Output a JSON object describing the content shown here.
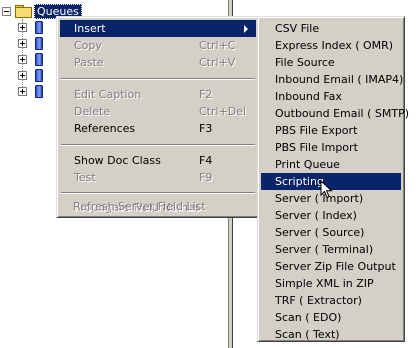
{
  "tree": {
    "root_label": "Queues",
    "child_count": 5
  },
  "context_menu": {
    "items": [
      {
        "label": "Insert",
        "shortcut": "",
        "disabled": false,
        "highlighted": true,
        "submenu": true
      },
      {
        "label": "Copy",
        "shortcut": "Ctrl+C",
        "disabled": true
      },
      {
        "label": "Paste",
        "shortcut": "Ctrl+V",
        "disabled": true
      },
      {
        "label": "Edit Caption",
        "shortcut": "F2",
        "disabled": true
      },
      {
        "label": "Delete",
        "shortcut": "Ctrl+Del",
        "disabled": true
      },
      {
        "label": "References",
        "shortcut": "F3",
        "disabled": false
      },
      {
        "label": "Show Doc Class",
        "shortcut": "F4",
        "disabled": false
      },
      {
        "label": "Test",
        "shortcut": "F9",
        "disabled": true
      },
      {
        "label": "Propagate Field Names",
        "shortcut": "",
        "disabled": true
      },
      {
        "label": "Refresh Server Field List",
        "shortcut": "",
        "disabled": true
      }
    ]
  },
  "insert_submenu": {
    "items": [
      {
        "label": "CSV File"
      },
      {
        "label": "Express Index ( OMR)"
      },
      {
        "label": "File Source"
      },
      {
        "label": "Inbound Email ( IMAP4)"
      },
      {
        "label": "Inbound Fax"
      },
      {
        "label": "Outbound Email ( SMTP)"
      },
      {
        "label": "PBS File Export"
      },
      {
        "label": "PBS File Import"
      },
      {
        "label": "Print Queue"
      },
      {
        "label": "Scripting",
        "highlighted": true
      },
      {
        "label": "Server ( Import)"
      },
      {
        "label": "Server ( Index)"
      },
      {
        "label": "Server ( Source)"
      },
      {
        "label": "Server ( Terminal)"
      },
      {
        "label": "Server Zip File Output"
      },
      {
        "label": "Simple XML in ZIP"
      },
      {
        "label": "TRF ( Extractor)"
      },
      {
        "label": "Scan ( EDO)"
      },
      {
        "label": "Scan ( Text)"
      }
    ]
  },
  "colors": {
    "highlight": "#0a246a",
    "menu_face": "#d4d0c8",
    "disabled_text": "#808080"
  }
}
